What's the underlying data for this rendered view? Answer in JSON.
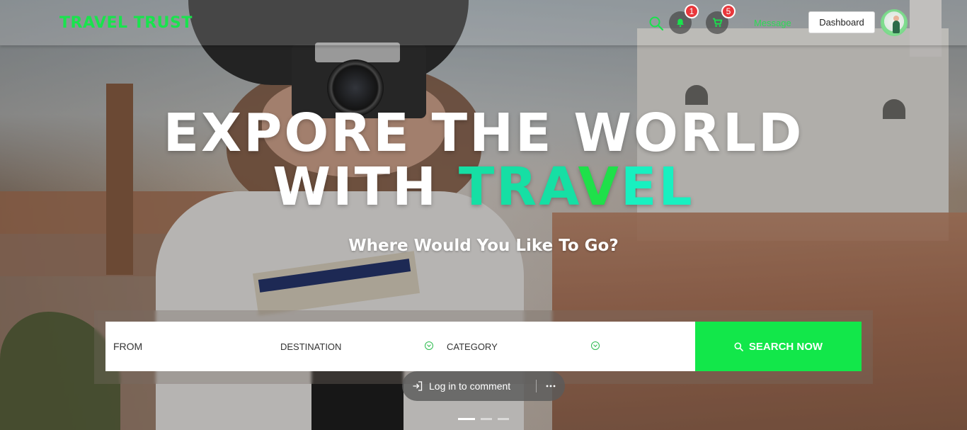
{
  "brand": {
    "name": "TRAVEL TRUST",
    "accent_color": "#19e34d"
  },
  "nav": {
    "search_icon": "search-icon",
    "notifications": {
      "icon": "bell-icon",
      "count": "1"
    },
    "cart": {
      "icon": "cart-icon",
      "count": "5"
    },
    "message_label": "Message",
    "dashboard_label": "Dashboard",
    "avatar_icon": "user-avatar"
  },
  "hero": {
    "title_line1": "EXPORE THE WORLD",
    "title_line2_prefix": "WITH ",
    "title_line2_accent_a": "TRA",
    "title_line2_accent_v": "V",
    "title_line2_accent_b": "EL",
    "subtitle": "Where Would You Like To Go?"
  },
  "search": {
    "from_label": "FROM",
    "destination_label": "DESTINATION",
    "category_label": "CATEGORY",
    "button_label": "SEARCH NOW",
    "button_color": "#12e74a"
  },
  "comment": {
    "login_label": "Log in to comment",
    "more_icon": "ellipsis-icon"
  },
  "slider": {
    "slides": 3,
    "active": 1
  }
}
